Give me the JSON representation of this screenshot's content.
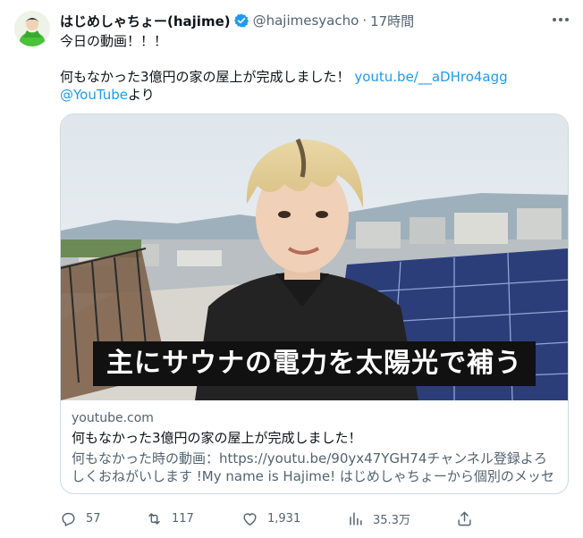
{
  "tweet": {
    "display_name": "はじめしゃちょー(hajime)",
    "handle": "@hajimesyacho",
    "separator": "·",
    "time": "17時間",
    "text_line1": "今日の動画！！！",
    "text_line2_plain": "何もなかった3億円の家の屋上が完成しました！ ",
    "text_line2_link": "youtu.be/__aDHro4agg",
    "text_line3_link": "@YouTube",
    "text_line3_plain": "より"
  },
  "card": {
    "thumbnail_caption": "主にサウナの電力を太陽光で補う",
    "domain": "youtube.com",
    "title": "何もなかった3億円の家の屋上が完成しました！",
    "description": "何もなかった時の動画：https://youtu.be/90yx47YGH74チャンネル登録よろしくおねがいします !My name is Hajime! はじめしゃちょーから個別のメッセージ…"
  },
  "actions": {
    "replies": "57",
    "retweets": "117",
    "likes": "1,931",
    "views": "35.3万"
  },
  "colors": {
    "link": "#1d9bf0",
    "secondary_text": "#536471",
    "verified_badge": "#1d9bf0",
    "border": "#cfd9de"
  },
  "icons": {
    "verified": "verified-badge-icon",
    "more": "more-horizontal-icon",
    "reply": "reply-icon",
    "retweet": "retweet-icon",
    "like": "heart-icon",
    "views": "views-bar-chart-icon",
    "share": "share-icon"
  }
}
